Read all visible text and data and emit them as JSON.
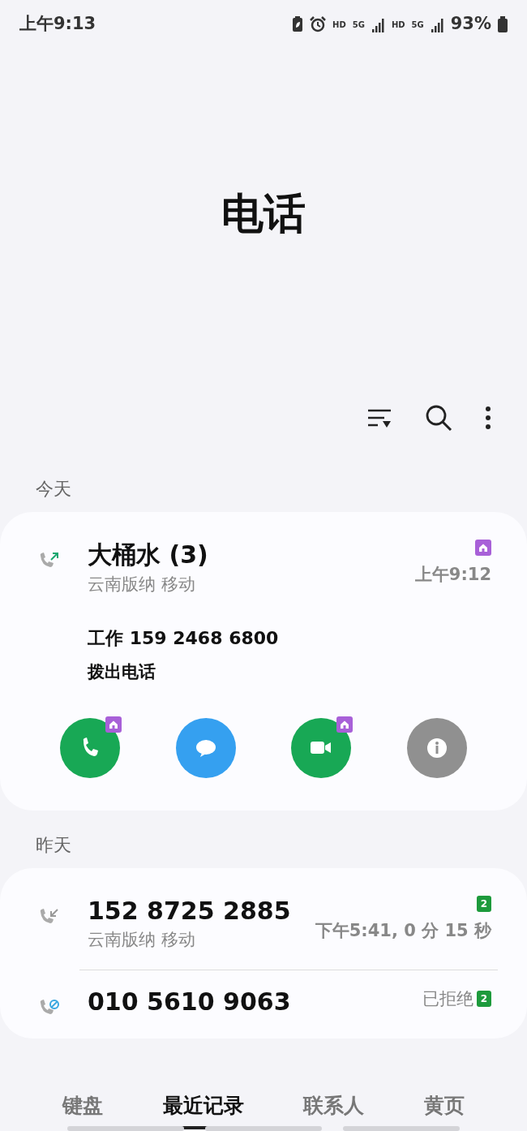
{
  "status_bar": {
    "time": "上午9:13",
    "network_labels": [
      "HD",
      "5G",
      "HD",
      "5G"
    ],
    "battery": "93%"
  },
  "title": "电话",
  "sections": [
    {
      "header": "今天",
      "calls": [
        {
          "kind": "outgoing",
          "name": "大桶水 (3)",
          "location": "云南版纳 移动",
          "sim": {
            "kind": "home"
          },
          "time": "上午9:12",
          "detail_label": "工作",
          "detail_number": "159 2468 6800",
          "detail_type": "拨出电话",
          "actions": [
            {
              "kind": "call",
              "home_sim": true
            },
            {
              "kind": "message",
              "home_sim": false
            },
            {
              "kind": "video",
              "home_sim": true
            },
            {
              "kind": "info",
              "home_sim": false
            }
          ]
        }
      ]
    },
    {
      "header": "昨天",
      "calls": [
        {
          "kind": "incoming",
          "name": "152 8725 2885",
          "location": "云南版纳 移动",
          "sim": {
            "kind": "number",
            "label": "2"
          },
          "time": "下午5:41, 0 分 15 秒"
        },
        {
          "kind": "rejected",
          "name": "010 5610 9063",
          "sim": {
            "kind": "number",
            "label": "2"
          },
          "time": "已拒绝"
        }
      ]
    }
  ],
  "nav_tabs": [
    {
      "label": "键盘",
      "selected": false
    },
    {
      "label": "最近记录",
      "selected": true
    },
    {
      "label": "联系人",
      "selected": false
    },
    {
      "label": "黄页",
      "selected": false
    }
  ]
}
